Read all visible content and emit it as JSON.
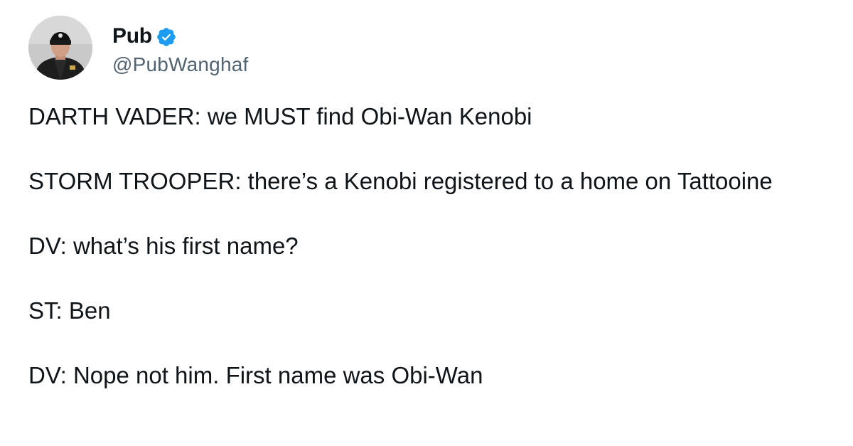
{
  "tweet": {
    "author": {
      "display_name": "Pub",
      "handle": "@PubWanghaf",
      "verified": true,
      "avatar_icon": "profile-photo",
      "verified_icon": "verified-badge-icon",
      "verified_color": "#1d9bf0"
    },
    "paragraphs": [
      "DARTH VADER: we MUST find Obi-Wan Kenobi",
      "STORM TROOPER: there’s a Kenobi registered to a home on Tattooine",
      "DV: what’s his first name?",
      "ST: Ben",
      "DV: Nope not him. First name was Obi-Wan"
    ]
  }
}
